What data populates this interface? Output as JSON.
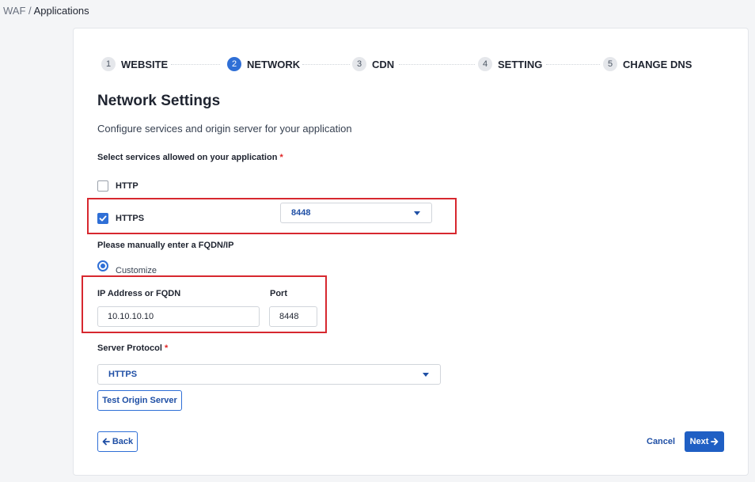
{
  "breadcrumb": {
    "root": "WAF",
    "separator": "/",
    "current": "Applications"
  },
  "steps": [
    {
      "number": "1",
      "label": "WEBSITE",
      "active": false
    },
    {
      "number": "2",
      "label": "NETWORK",
      "active": true
    },
    {
      "number": "3",
      "label": "CDN",
      "active": false
    },
    {
      "number": "4",
      "label": "SETTING",
      "active": false
    },
    {
      "number": "5",
      "label": "CHANGE DNS",
      "active": false
    }
  ],
  "page": {
    "title": "Network Settings",
    "subtitle": "Configure services and origin server for your application"
  },
  "services": {
    "label": "Select services allowed on your application",
    "required_mark": "*",
    "http": {
      "label": "HTTP",
      "checked": false
    },
    "https": {
      "label": "HTTPS",
      "checked": true,
      "port_value": "8448"
    }
  },
  "origin": {
    "label": "Please manually enter a FQDN/IP",
    "option_label": "Customize",
    "ip_label": "IP Address or FQDN",
    "ip_value": "10.10.10.10",
    "port_label": "Port",
    "port_value": "8448"
  },
  "protocol": {
    "label": "Server Protocol",
    "required_mark": "*",
    "value": "HTTPS"
  },
  "actions": {
    "test_label": "Test Origin Server",
    "back_label": "Back",
    "cancel_label": "Cancel",
    "next_label": "Next"
  },
  "colors": {
    "accent": "#2f6fd6",
    "primary_button": "#1f5fc4",
    "highlight": "#d7282f",
    "required": "#e02424"
  }
}
